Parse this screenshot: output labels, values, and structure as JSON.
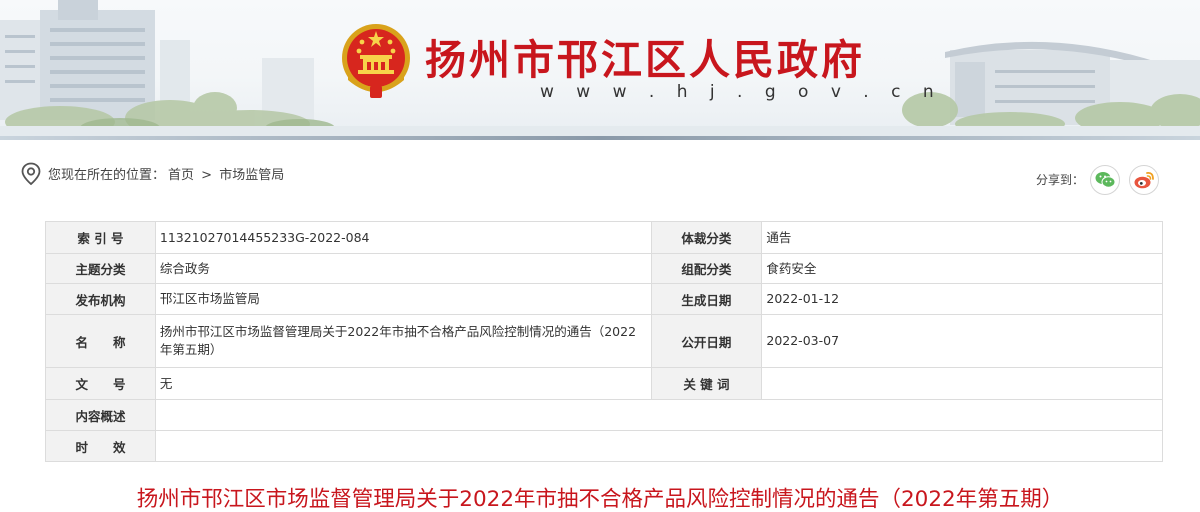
{
  "header": {
    "title": "扬州市邗江区人民政府",
    "url": "w w w . h j . g o v . c n",
    "emblem_icon": "national-emblem-icon",
    "accent_color": "#c8161d"
  },
  "breadcrumb": {
    "prefix": "您现在所在的位置：",
    "home": "首页",
    "separator": ">",
    "current": "市场监管局",
    "icon": "location-pin-icon"
  },
  "share": {
    "label": "分享到：",
    "buttons": [
      {
        "icon": "wechat-icon",
        "color": "#5cb85c"
      },
      {
        "icon": "weibo-icon",
        "color": "#e8553e"
      }
    ]
  },
  "info_table": {
    "index_no": {
      "label": "索 引 号",
      "value": "11321027014455233G-2022-084"
    },
    "genre": {
      "label": "体裁分类",
      "value": "通告"
    },
    "topic": {
      "label": "主题分类",
      "value": "综合政务"
    },
    "org_category": {
      "label": "组配分类",
      "value": "食药安全"
    },
    "publisher": {
      "label": "发布机构",
      "value": "邗江区市场监管局"
    },
    "created_date": {
      "label": "生成日期",
      "value": "2022-01-12"
    },
    "name": {
      "label": "名　　称",
      "value": "扬州市邗江区市场监督管理局关于2022年市抽不合格产品风险控制情况的通告（2022年第五期）"
    },
    "public_date": {
      "label": "公开日期",
      "value": "2022-03-07"
    },
    "doc_no": {
      "label": "文　　号",
      "value": "无"
    },
    "keywords": {
      "label": "关 键 词",
      "value": ""
    },
    "summary": {
      "label": "内容概述",
      "value": ""
    },
    "validity": {
      "label": "时　　效",
      "value": ""
    }
  },
  "article": {
    "title": "扬州市邗江区市场监督管理局关于2022年市抽不合格产品风险控制情况的通告（2022年第五期）"
  }
}
